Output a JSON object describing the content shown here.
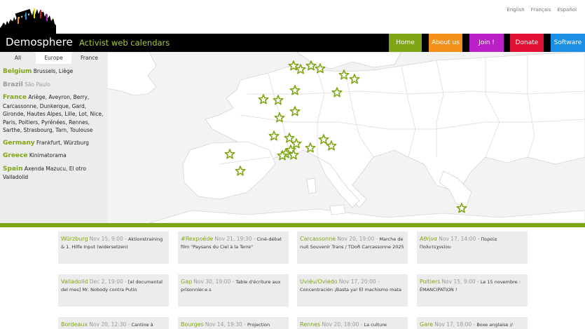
{
  "languages": [
    "English",
    "Français",
    "Español"
  ],
  "header": {
    "site_name": "Demosphere",
    "tagline": "Activist web calendars",
    "nav": {
      "home": "Home",
      "about": "About us",
      "join": "Join !",
      "donate": "Donate",
      "software": "Software"
    }
  },
  "sidebar": {
    "tabs": [
      "All",
      "Europe",
      "France"
    ],
    "active_tab": "Europe",
    "countries": [
      {
        "name": "Belgium",
        "cities": "Brussels, Liège",
        "active": true
      },
      {
        "name": "Brazil",
        "cities": "São Paulo",
        "active": false
      },
      {
        "name": "France",
        "cities": "Ariège, Aveyron, Berry, Carcassonne, Dunkerque, Gard, Gironde, Hautes Alpes, Lille, Lot, Nice, Paris, Poitiers, Pyrénées, Rennes, Sarthe, Strasbourg, Tarn, Toulouse",
        "active": true
      },
      {
        "name": "Germany",
        "cities": "Frankfurt, Würzburg",
        "active": true
      },
      {
        "name": "Greece",
        "cities": "Kinimatorama",
        "active": true
      },
      {
        "name": "Spain",
        "cities": "Axenda Mazucu, El otro Valladolid",
        "active": true
      }
    ]
  },
  "colors": {
    "accent_green": "#7ea614",
    "about_orange": "#f39019",
    "join_purple": "#bb1fc8",
    "donate_red": "#e01035",
    "software_blue": "#1a8fe3"
  },
  "map_icon": "star-marker-icon",
  "events": [
    {
      "city": "Würzburg",
      "date": "Nov 15, 9:00 -",
      "title": "Aktionstraining & 1. Hilfe Input (widersetzen)"
    },
    {
      "city": "#Rexpoéde",
      "date": "Nov 21, 19:30 -",
      "title": "Ciné-débat film \"Paysans du Ciel à la Terre\""
    },
    {
      "city": "Carcassonne",
      "date": "Nov 20, 19:00 -",
      "title": "Marche de nuit Souvenir Trans / TDoR Carcassonne 2025"
    },
    {
      "city": "Αθήνα",
      "date": "Nov 17, 14:00 -",
      "title": "Πορεία Πολυτεχνείου"
    },
    {
      "city": "Valladolid",
      "date": "Dec 2, 19:00 -",
      "title": "[el documental del mes] Mr. Nobody contra Putin"
    },
    {
      "city": "Gap",
      "date": "Nov 30, 19:00 -",
      "title": "Table d'écriture aux prisonnier.e.s"
    },
    {
      "city": "Uviéu/Oviedo",
      "date": "Nov 17, 20:00 -",
      "title": "Concentración ¡Basta ya! El machismo mata"
    },
    {
      "city": "Poitiers",
      "date": "Nov 15, 9:00 -",
      "title": "Le 15 novembre : ÉMANCIPATION !"
    },
    {
      "city": "Bordeaux",
      "date": "Nov 20, 12:30 -",
      "title": "Cantine à"
    },
    {
      "city": "Bourges",
      "date": "Nov 14, 19:30 -",
      "title": "Projection"
    },
    {
      "city": "Rennes",
      "date": "Nov 20, 18:00 -",
      "title": "La culture"
    },
    {
      "city": "Gare",
      "date": "Nov 17, 18:00 -",
      "title": "Boxe anglaise //"
    }
  ]
}
